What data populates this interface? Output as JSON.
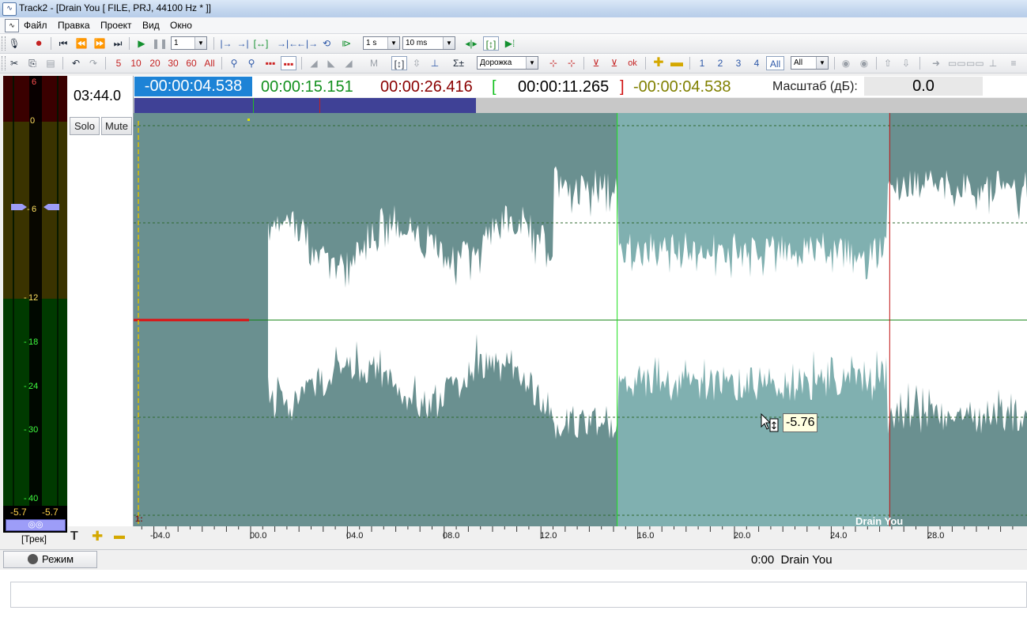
{
  "window": {
    "title": "Track2 - [Drain You [ FILE, PRJ, 44100 Hz * ]]",
    "app_icon": "waveform-app-icon"
  },
  "menu": {
    "items": [
      "Файл",
      "Правка",
      "Проект",
      "Вид",
      "Окно"
    ]
  },
  "toolbar1": {
    "step_value": "1",
    "zoom_step": "1 s",
    "fine_step": "10 ms"
  },
  "toolbar2": {
    "seconds_buttons": [
      "5",
      "10",
      "20",
      "30",
      "60",
      "All"
    ],
    "track_mode": "Дорожка",
    "track_numbers": [
      "1",
      "2",
      "3",
      "4",
      "All"
    ],
    "track_filter": "All",
    "ok_label": "ok",
    "m_label": "M",
    "sigma_label": "Σ±"
  },
  "meter": {
    "ticks": [
      "6",
      "0",
      "6",
      "12",
      "18",
      "24",
      "30",
      "40"
    ],
    "tick_prefix": [
      "",
      "",
      "-",
      "-",
      "-",
      "-",
      "-",
      "-"
    ],
    "left_value": "-5.7",
    "right_value": "-5.7",
    "link_icon": "link-rings-icon",
    "level_db": -5.7
  },
  "info": {
    "total_time": "03:44.0",
    "solo": "Solo",
    "mute": "Mute"
  },
  "readout": {
    "cursor": "-00:00:04.538",
    "sel_start": "00:00:15.151",
    "sel_end": "00:00:26.416",
    "bracket_open": "[",
    "length": "00:00:11.265",
    "bracket_close": "]",
    "offset": "-00:00:04.538",
    "scale_label": "Масштаб (дБ):",
    "scale_value": "0.0"
  },
  "waveform": {
    "track_name": "Drain You",
    "track_index": "1:",
    "tooltip": "-5.76",
    "selection_start_s": 15.151,
    "selection_end_s": 26.416,
    "view_start_s": -4.538,
    "audio_start_s": 0.0
  },
  "ruler": {
    "labels": [
      "-04.0",
      "00.0",
      "04.0",
      "08.0",
      "12.0",
      "16.0",
      "20.0",
      "24.0",
      "28.0"
    ]
  },
  "bottom": {
    "track_label": "[Трек]",
    "mode_label": "Режим",
    "status_time": "0:00",
    "status_track": "Drain You"
  },
  "colors": {
    "wave_fill": "#6a9090",
    "wave_selected": "#80b0b0",
    "readout_cursor": "#1d83d6",
    "sel_start": "#12901e",
    "sel_end": "#8a0000",
    "offset": "#808000",
    "overview": "#3f4196"
  }
}
